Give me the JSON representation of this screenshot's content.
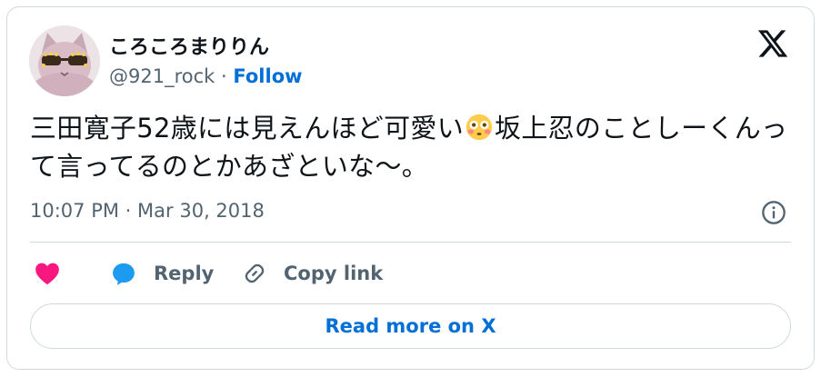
{
  "tweet": {
    "author": {
      "display_name": "ころころまりりん",
      "handle": "@921_rock",
      "separator": "·",
      "follow_label": "Follow",
      "avatar_icon": "cat-with-sunglasses-avatar"
    },
    "text_part1": "三田寛子52歳には見えんほど可愛い",
    "emoji": "flushed-face-emoji",
    "text_part2": "坂上忍のことしーくんって言ってるのとかあざといな〜。",
    "time": "10:07 PM",
    "date_separator": "·",
    "date": "Mar 30, 2018",
    "actions": {
      "like_icon": "heart-icon",
      "reply_label": "Reply",
      "copy_link_label": "Copy link"
    },
    "read_more_label": "Read more on X"
  },
  "colors": {
    "text": "#0f1419",
    "secondary": "#536471",
    "link": "#006fd6",
    "like": "#f91880",
    "reply": "#1d9bf0",
    "border": "#cfd9de"
  }
}
